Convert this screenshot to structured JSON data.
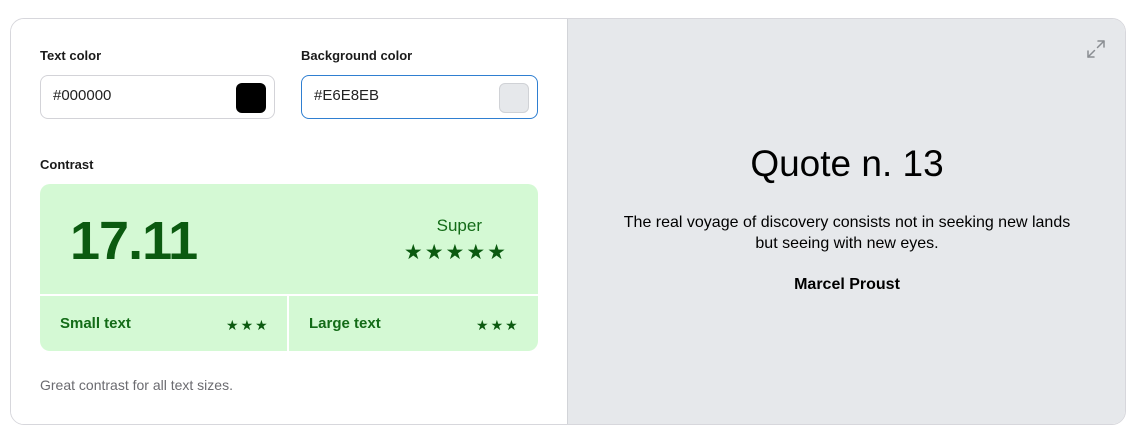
{
  "text_color": {
    "label": "Text color",
    "value": "#000000",
    "swatch": "#000000"
  },
  "background_color": {
    "label": "Background color",
    "value": "#E6E8EB",
    "swatch": "#E6E8EB"
  },
  "contrast": {
    "label": "Contrast",
    "ratio": "17.11",
    "rating": "Super",
    "rating_stars": 5,
    "small_text": {
      "label": "Small text",
      "stars": 3
    },
    "large_text": {
      "label": "Large text",
      "stars": 3
    },
    "hint": "Great contrast for all text sizes.",
    "colors": {
      "box": "#D4F9D4",
      "text": "#0B5A10"
    }
  },
  "preview": {
    "title": "Quote n. 13",
    "quote": "The real voyage of discovery consists not in seeking new lands but seeing with new eyes.",
    "author": "Marcel Proust",
    "expand_icon": "expand-icon"
  }
}
